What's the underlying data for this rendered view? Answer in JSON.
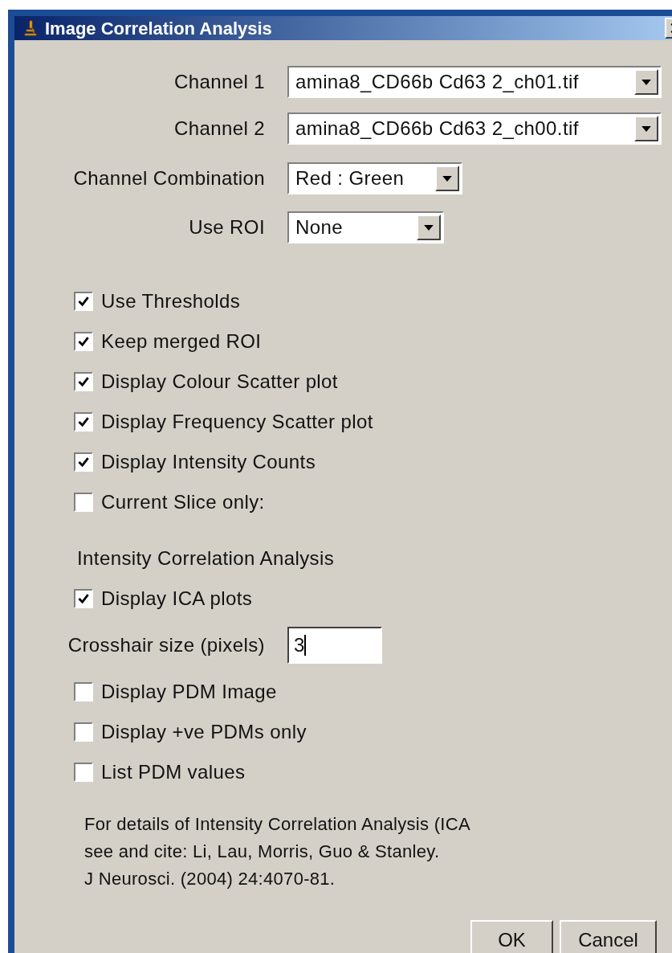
{
  "window": {
    "title": "Image Correlation Analysis"
  },
  "dropdowns": [
    {
      "label": "Channel 1",
      "value": "amina8_CD66b Cd63 2_ch01.tif"
    },
    {
      "label": "Channel 2",
      "value": "amina8_CD66b Cd63 2_ch00.tif"
    },
    {
      "label": "Channel Combination",
      "value": "Red : Green"
    },
    {
      "label": "Use ROI",
      "value": "None"
    }
  ],
  "options": [
    {
      "label": "Use Thresholds",
      "checked": true
    },
    {
      "label": "Keep merged ROI",
      "checked": true
    },
    {
      "label": "Display Colour Scatter plot",
      "checked": true
    },
    {
      "label": "Display Frequency Scatter plot",
      "checked": true
    },
    {
      "label": "Display Intensity Counts",
      "checked": true
    },
    {
      "label": "Current Slice only:",
      "checked": false
    }
  ],
  "ica_section": {
    "heading": "Intensity Correlation Analysis",
    "options": [
      {
        "label": "Display ICA plots",
        "checked": true
      }
    ],
    "crosshair": {
      "label": "Crosshair size (pixels)",
      "value": "3"
    },
    "pdm_options": [
      {
        "label": "Display PDM Image",
        "checked": false
      },
      {
        "label": "Display +ve PDMs only",
        "checked": false
      },
      {
        "label": "List PDM values",
        "checked": false
      }
    ]
  },
  "note_lines": [
    "For details of Intensity Correlation Analysis (ICA",
    "see and cite: Li, Lau, Morris, Guo & Stanley.",
    "J Neurosci. (2004) 24:4070-81."
  ],
  "buttons": [
    "OK",
    "Cancel"
  ]
}
